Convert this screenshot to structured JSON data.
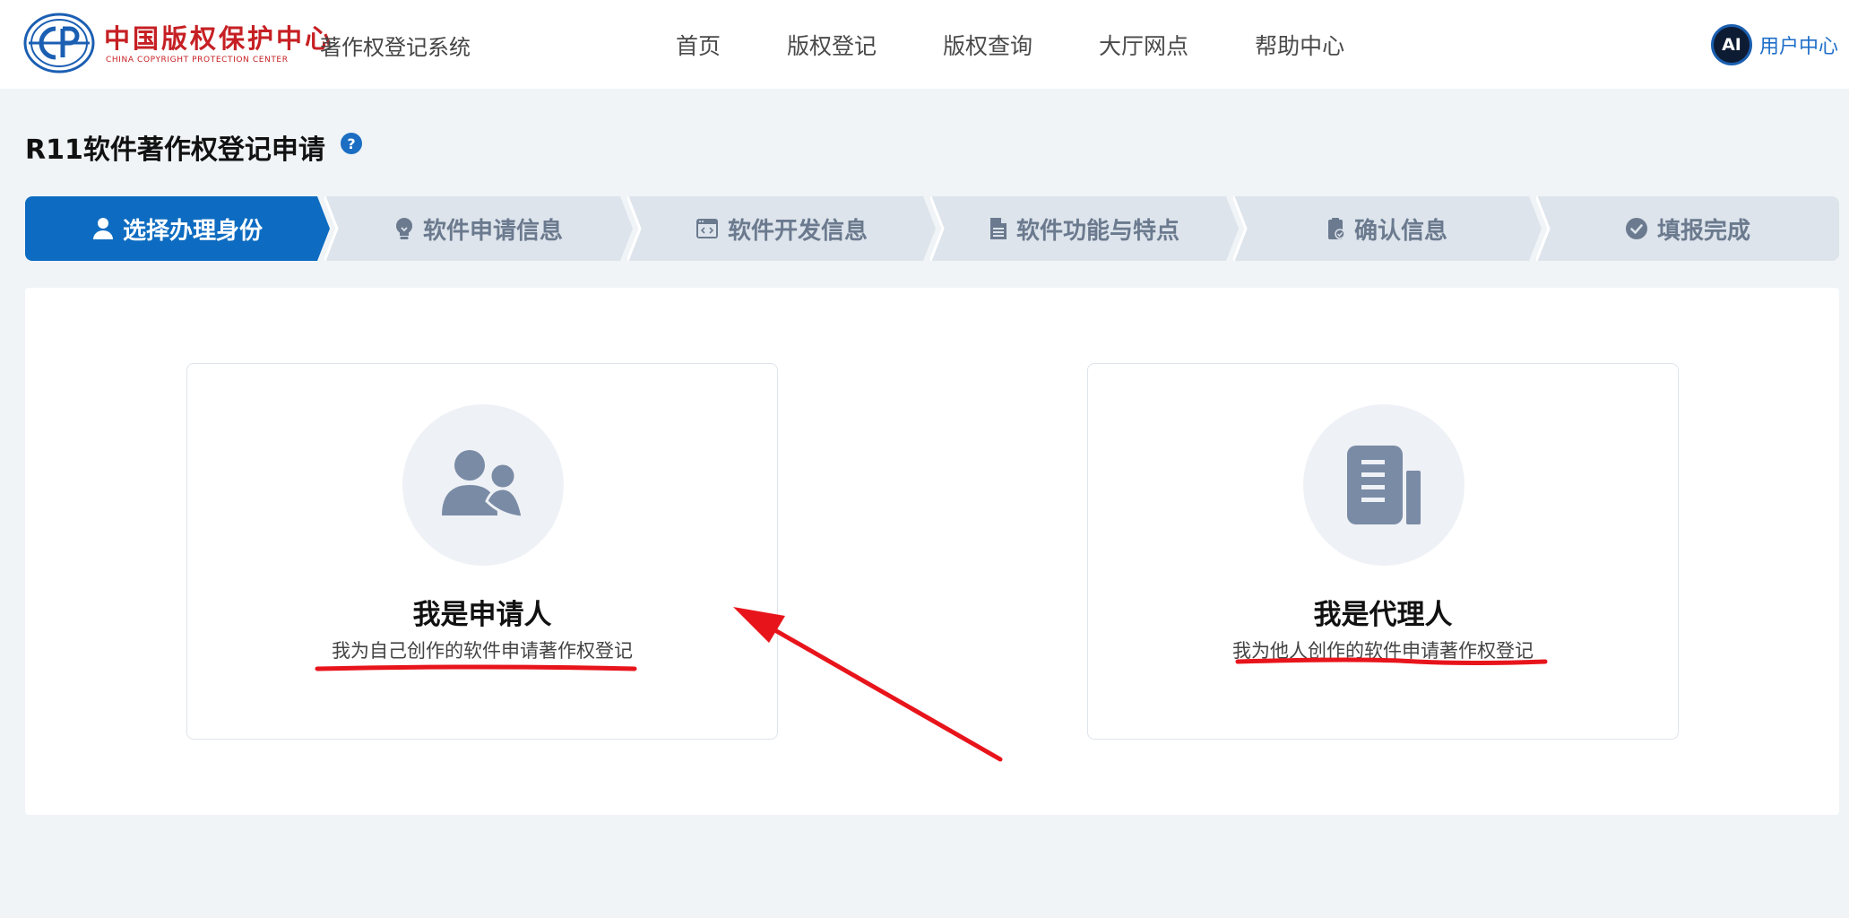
{
  "header": {
    "logo_cn": "中国版权保护中心",
    "logo_en": "CHINA COPYRIGHT PROTECTION CENTER",
    "system_name": "著作权登记系统",
    "nav": [
      "首页",
      "版权登记",
      "版权查询",
      "大厅网点",
      "帮助中心"
    ],
    "avatar_text": "AI",
    "user_label": "用户中心"
  },
  "page": {
    "title": "R11软件著作权登记申请",
    "help_icon_text": "?"
  },
  "steps": [
    {
      "label": "选择办理身份",
      "icon": "user-icon",
      "active": true
    },
    {
      "label": "软件申请信息",
      "icon": "lightbulb-icon",
      "active": false
    },
    {
      "label": "软件开发信息",
      "icon": "code-window-icon",
      "active": false
    },
    {
      "label": "软件功能与特点",
      "icon": "document-icon",
      "active": false
    },
    {
      "label": "确认信息",
      "icon": "clipboard-check-icon",
      "active": false
    },
    {
      "label": "填报完成",
      "icon": "check-circle-icon",
      "active": false
    }
  ],
  "cards": {
    "applicant": {
      "title": "我是申请人",
      "desc": "我为自己创作的软件申请著作权登记",
      "icon": "users-icon"
    },
    "agent": {
      "title": "我是代理人",
      "desc": "我为他人创作的软件申请著作权登记",
      "icon": "building-document-icon"
    }
  },
  "colors": {
    "primary": "#0d6cc1",
    "step_inactive_bg": "#dde4ec",
    "step_inactive_text": "#6b7a8e",
    "annotation_red": "#e8141b",
    "icon_gray": "#7a8ba5",
    "page_bg": "#f0f4f7"
  }
}
